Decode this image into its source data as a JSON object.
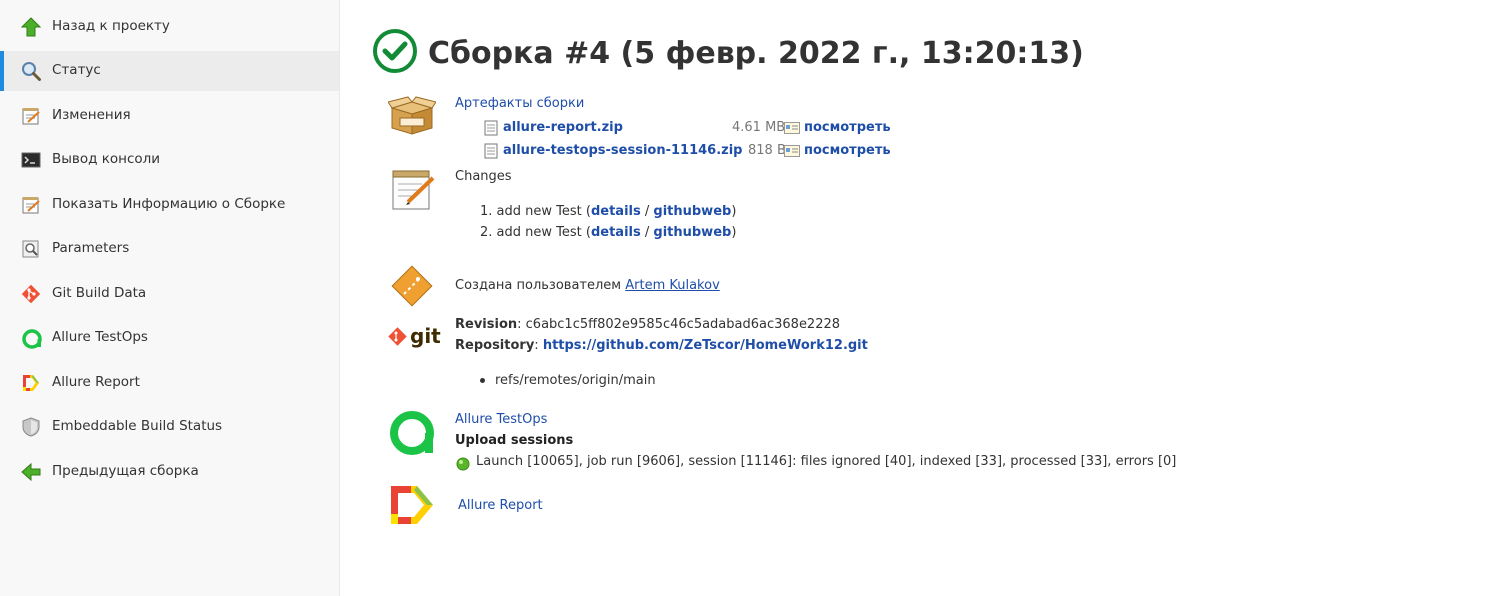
{
  "sidebar": {
    "items": [
      {
        "label": "Назад к проекту",
        "icon": "up-arrow-icon"
      },
      {
        "label": "Статус",
        "icon": "magnifier-icon",
        "active": true
      },
      {
        "label": "Изменения",
        "icon": "notepad-icon"
      },
      {
        "label": "Вывод консоли",
        "icon": "terminal-icon"
      },
      {
        "label": "Показать Информацию о Сборке",
        "icon": "notepad-icon"
      },
      {
        "label": "Parameters",
        "icon": "magnifier-icon"
      },
      {
        "label": "Git Build Data",
        "icon": "git-icon"
      },
      {
        "label": "Allure TestOps",
        "icon": "allure-testops-icon"
      },
      {
        "label": "Allure Report",
        "icon": "allure-report-icon"
      },
      {
        "label": "Embeddable Build Status",
        "icon": "shield-icon"
      },
      {
        "label": "Предыдущая сборка",
        "icon": "left-arrow-icon"
      }
    ]
  },
  "build": {
    "title": "Сборка #4 (5 февр. 2022 г., 13:20:13)",
    "status": "success"
  },
  "artifacts": {
    "heading": "Артефакты сборки",
    "files": [
      {
        "name": "allure-report.zip",
        "size": "4.61 MB",
        "view": "посмотреть"
      },
      {
        "name": "allure-testops-session-11146.zip",
        "size": "818 B",
        "view": "посмотреть"
      }
    ]
  },
  "changes": {
    "heading": "Changes",
    "items": [
      {
        "num": "1.",
        "text": "add new Test (",
        "details": "details",
        "sep": " / ",
        "web": "githubweb",
        "close": ")"
      },
      {
        "num": "2.",
        "text": "add new Test (",
        "details": "details",
        "sep": " / ",
        "web": "githubweb",
        "close": ")"
      }
    ]
  },
  "cause": {
    "prefix": "Создана пользователем ",
    "user": "Artem Kulakov"
  },
  "git": {
    "logo_text": "git",
    "revision_label": "Revision",
    "revision": ": c6abc1c5ff802e9585c46c5adabad6ac368e2228",
    "repository_label": "Repository",
    "repository_sep": ": ",
    "repository": "https://github.com/ZeTscor/HomeWork12.git",
    "branch": "refs/remotes/origin/main"
  },
  "testops": {
    "link": "Allure TestOps",
    "upload_heading": "Upload sessions",
    "session": "Launch [10065], job run [9606], session [11146]: files ignored [40], indexed [33], processed [33], errors [0]"
  },
  "allure_report": {
    "link": "Allure Report"
  },
  "colors": {
    "accent": "#1d8ce0",
    "success": "#138a36",
    "link": "#1f4ea8",
    "allure_green": "#1bc447"
  }
}
